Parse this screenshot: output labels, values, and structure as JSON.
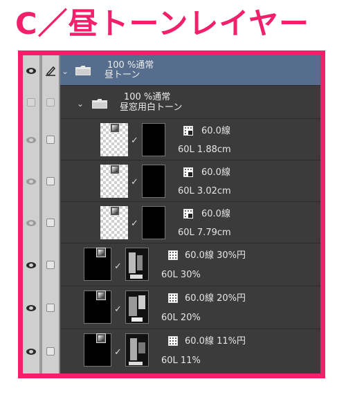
{
  "title": "C／昼トーンレイヤー",
  "layers": [
    {
      "line1": "100 %通常",
      "line2": "昼トーン"
    },
    {
      "line1": "100 %通常",
      "line2": "昼窓用白トーン"
    }
  ],
  "tone_layers": [
    {
      "setting": "60.0線",
      "detail": "60L 1.88cm"
    },
    {
      "setting": "60.0線",
      "detail": "60L 3.02cm"
    },
    {
      "setting": "60.0線",
      "detail": "60L 7.79cm"
    },
    {
      "setting": "60.0線 30%円",
      "detail": "60L 30%"
    },
    {
      "setting": "60.0線 20%円",
      "detail": "60L 20%"
    },
    {
      "setting": "60.0線 11%円",
      "detail": "60L 11%"
    }
  ],
  "icons": {
    "visibility": "eye-icon",
    "edit": "pencil-icon",
    "expand": "chevron-down-icon",
    "folder": "folder-icon",
    "tone": "halftone-icon",
    "link": "check-link-icon"
  },
  "colors": {
    "accent": "#f0206a",
    "panel": "#3b3b3b",
    "selected": "#566d8e"
  }
}
